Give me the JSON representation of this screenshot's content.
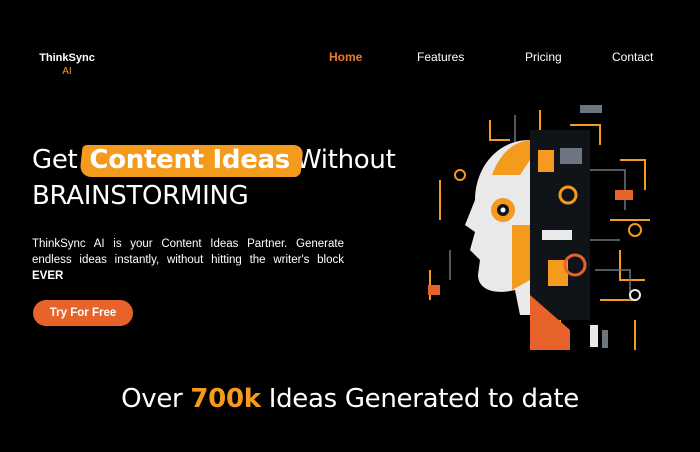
{
  "brand": {
    "name_line1": "ThinkSync",
    "name_line2": "AI"
  },
  "nav": {
    "items": [
      "Home",
      "Features",
      "Pricing",
      "Contact"
    ],
    "active": "Home"
  },
  "hero": {
    "title_pre": "Get",
    "title_highlight": "Content  Ideas",
    "title_post": "Without",
    "title_line2": "BRAINSTORMING",
    "description": "ThinkSync AI is your Content Ideas Partner. Generate endless ideas instantly, without hitting the writer's block ",
    "description_emphasis": "EVER",
    "cta_label": "Try For Free"
  },
  "stats": {
    "prefix": "Over",
    "number": "700k",
    "suffix": "Ideas Generated to date"
  },
  "illustration": {
    "icon": "ai-robot-head-icon"
  },
  "colors": {
    "accent_orange": "#f49a1d",
    "button_orange": "#e8632a",
    "background": "#000000"
  }
}
